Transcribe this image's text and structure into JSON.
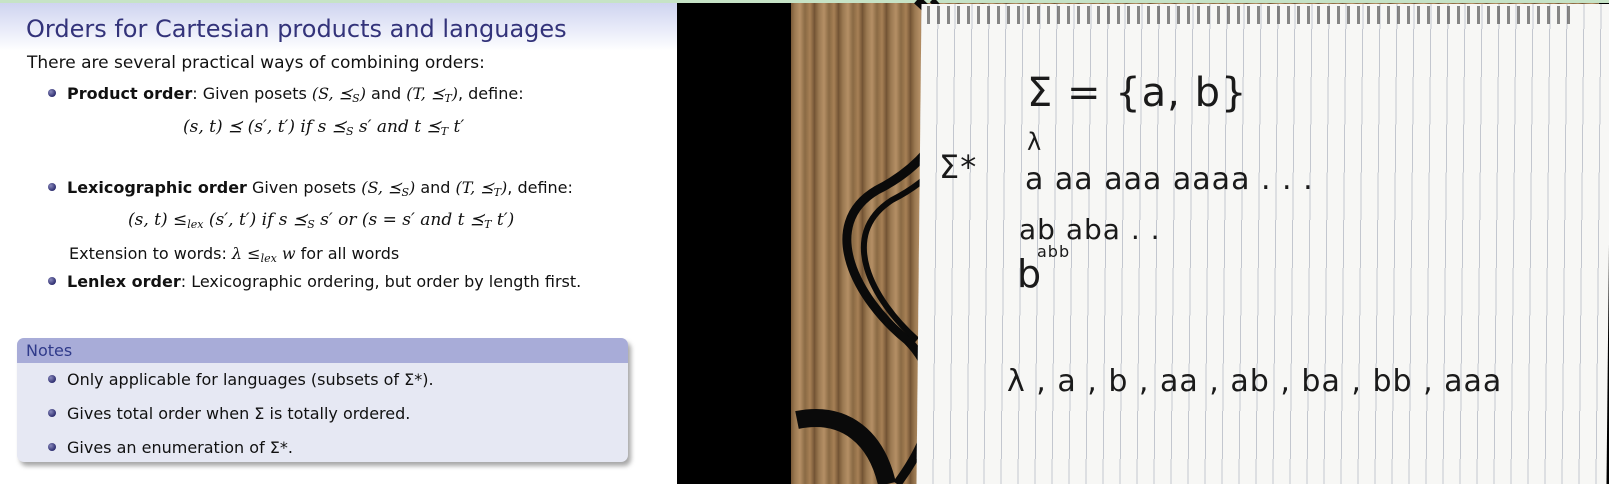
{
  "slide": {
    "title": "Orders for Cartesian products and languages",
    "intro": "There are several practical ways of combining orders:",
    "product": {
      "term": "Product order",
      "text_a": ": Given posets ",
      "text_b": " and ",
      "text_c": ", define:",
      "poset1": "(S, ⪯",
      "poset1_sub": "S",
      "poset2": "(T, ⪯",
      "poset2_sub": "T",
      "formula": "(s, t) ⪯ (s′, t′)   if  s ⪯",
      "formula_sub": "S",
      "formula_b": " s′ and t ⪯",
      "formula_sub2": "T",
      "formula_c": " t′"
    },
    "lex": {
      "term": "Lexicographic order",
      "text_a": " Given posets ",
      "text_b": " and ",
      "text_c": ", define:",
      "formula_a": "(s, t) ≤",
      "formula_sub": "lex",
      "formula_b": " (s′, t′)   if  s ⪯",
      "formula_sub2": "S",
      "formula_c": " s′ or (s = s′ and t ⪯",
      "formula_sub3": "T",
      "formula_d": " t′)",
      "extension_a": "Extension to words: ",
      "extension_m": "λ ≤",
      "extension_sub": "lex",
      "extension_w": " w",
      "extension_b": " for all words"
    },
    "lenlex": {
      "term": "Lenlex order",
      "text": ": Lexicographic ordering, but order by length first."
    },
    "notes": {
      "title": "Notes",
      "items": [
        "Only applicable for languages (subsets of Σ*).",
        "Gives total order when Σ is totally ordered.",
        "Gives an enumeration of Σ*."
      ]
    }
  },
  "video": {
    "lines": [
      "Σ = {a, b}",
      "λ",
      "Σ*",
      "a     aa     aaa     aaaa  . . .",
      "ab  aba  . .",
      "abb",
      "b",
      "λ ,  a ,  b ,  aa ,  ab ,  ba ,  bb ,  aaa"
    ]
  }
}
